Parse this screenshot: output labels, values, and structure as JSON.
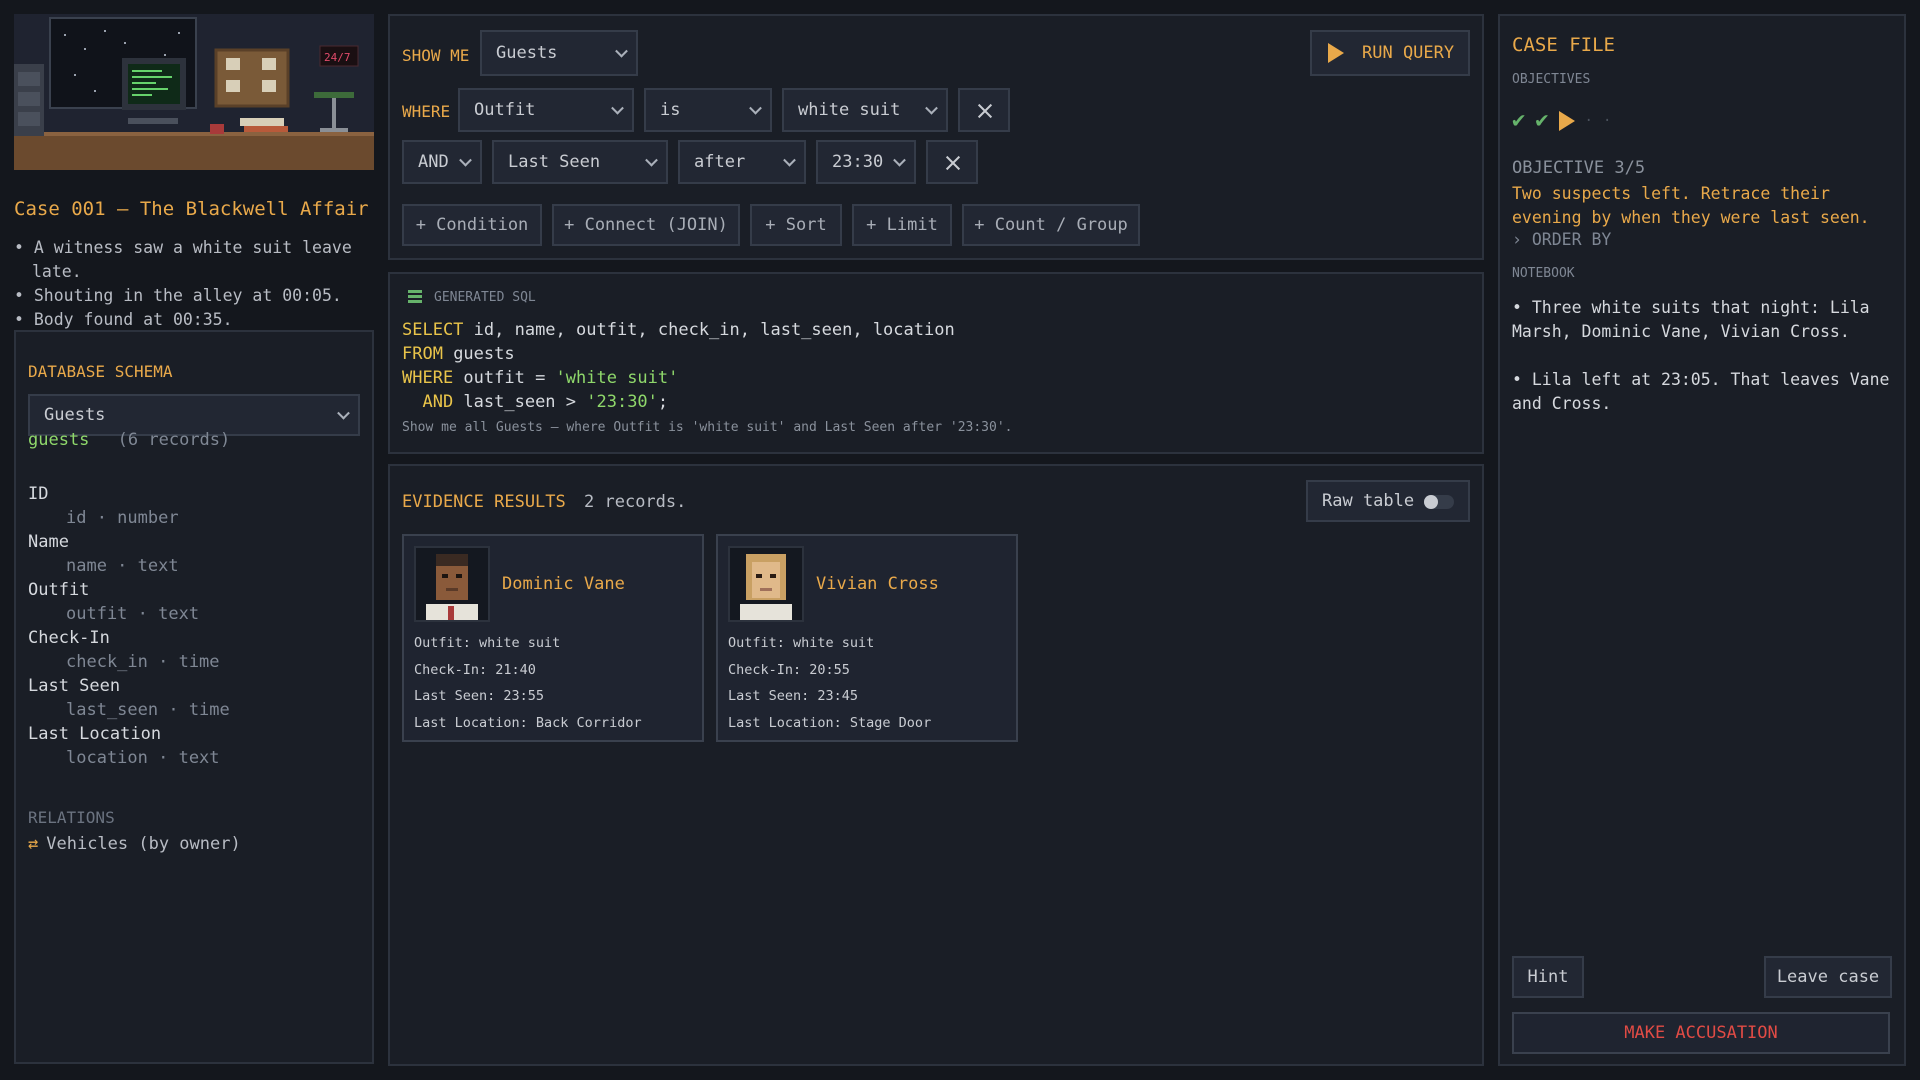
{
  "case": {
    "title": "Case 001 – The Blackwell Affair",
    "clues": [
      "• A witness saw a white suit leave late.",
      "• Shouting in the alley at 00:05.",
      "• Body found at 00:35."
    ],
    "scene_clock": "24/7"
  },
  "schema": {
    "header": "DATABASE SCHEMA",
    "selected_table": "Guests",
    "table_name": "guests",
    "record_count": "(6 records)",
    "fields": [
      {
        "name": "ID",
        "desc": "id · number"
      },
      {
        "name": "Name",
        "desc": "name · text"
      },
      {
        "name": "Outfit",
        "desc": "outfit · text"
      },
      {
        "name": "Check-In",
        "desc": "check_in · time"
      },
      {
        "name": "Last Seen",
        "desc": "last_seen · time"
      },
      {
        "name": "Last Location",
        "desc": "location · text"
      }
    ],
    "relations_header": "RELATIONS",
    "relation": "Vehicles (by owner)"
  },
  "query": {
    "show_me_label": "SHOW ME",
    "show_me_value": "Guests",
    "run_label": "RUN QUERY",
    "where_label": "WHERE",
    "cond1": {
      "field": "Outfit",
      "op": "is",
      "value": "white suit"
    },
    "cond2": {
      "joiner": "AND",
      "field": "Last Seen",
      "op": "after",
      "value": "23:30"
    },
    "buttons": [
      "+ Condition",
      "+ Connect (JOIN)",
      "+ Sort",
      "+ Limit",
      "+ Count / Group"
    ]
  },
  "sql": {
    "header": "GENERATED SQL",
    "select_kw": "SELECT",
    "select_cols": " id, name, outfit, check_in, last_seen, location",
    "from_kw": "FROM",
    "from_table": " guests",
    "where_kw": "WHERE",
    "where_cond": " outfit = ",
    "where_val": "'white suit'",
    "and_kw": "  AND",
    "and_cond": " last_seen > ",
    "and_val": "'23:30'",
    "and_end": ";",
    "description": "Show me all Guests — where Outfit is 'white suit' and Last Seen after '23:30'."
  },
  "results": {
    "header": "EVIDENCE RESULTS",
    "count": "2 records.",
    "raw_table_label": "Raw table",
    "raw_table_on": false,
    "cards": [
      {
        "name": "Dominic Vane",
        "outfit": "Outfit: white suit",
        "check_in": "Check-In: 21:40",
        "last_seen": "Last Seen: 23:55",
        "location": "Last Location: Back Corridor"
      },
      {
        "name": "Vivian Cross",
        "outfit": "Outfit: white suit",
        "check_in": "Check-In: 20:55",
        "last_seen": "Last Seen: 23:45",
        "location": "Last Location: Stage Door"
      }
    ]
  },
  "casefile": {
    "header": "CASE FILE",
    "objectives_header": "OBJECTIVES",
    "objective_status": [
      "done",
      "done",
      "current",
      "pending",
      "pending"
    ],
    "objective_number": "OBJECTIVE 3/5",
    "objective_text": "Two suspects left. Retrace their evening by when they were last seen.",
    "objective_hint": "› ORDER BY",
    "notebook_header": "NOTEBOOK",
    "notes": [
      "• Three white suits that night: Lila Marsh, Dominic Vane, Vivian Cross.",
      "• Lila left at 23:05. That leaves Vane and Cross."
    ],
    "hint_label": "Hint",
    "leave_label": "Leave case",
    "accuse_label": "MAKE ACCUSATION"
  },
  "colors": {
    "accent": "#e9a94a",
    "keyword": "#e9c44a",
    "string": "#8fd86b",
    "danger": "#e04b45",
    "check": "#66b36b"
  }
}
